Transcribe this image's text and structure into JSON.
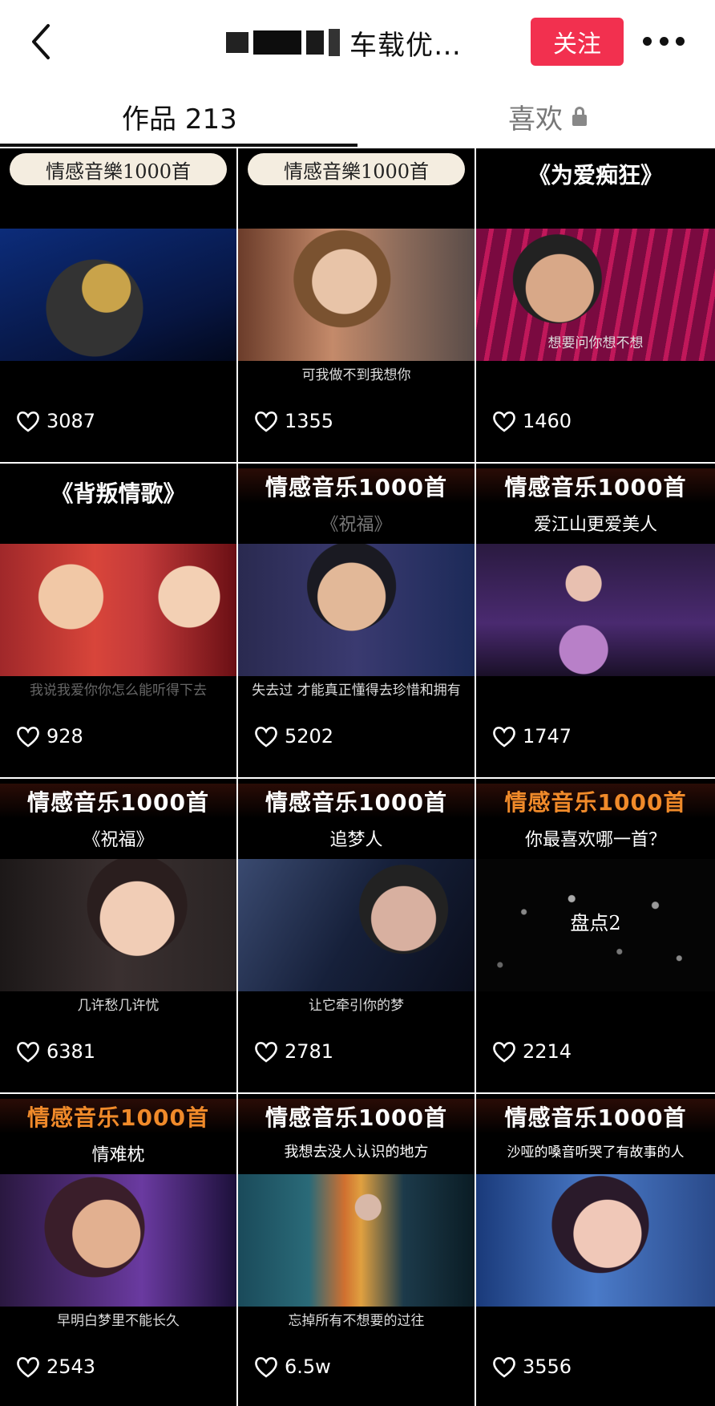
{
  "header": {
    "title": "车载优…",
    "follow_label": "关注"
  },
  "tabs": {
    "works_label": "作品 213",
    "likes_label": "喜欢"
  },
  "videos": [
    {
      "banner": "情感音樂1000首",
      "subtitle": "",
      "caption": "",
      "likes": "3087"
    },
    {
      "banner": "情感音樂1000首",
      "subtitle": "",
      "caption": "可我做不到我想你",
      "likes": "1355"
    },
    {
      "banner": "《为爱痴狂》",
      "subtitle": "",
      "caption": "想要问你想不想",
      "likes": "1460"
    },
    {
      "banner": "《背叛情歌》",
      "subtitle": "",
      "caption": "我说我爱你你怎么能听得下去",
      "likes": "928"
    },
    {
      "banner": "情感音乐1000首",
      "subtitle": "《祝福》",
      "caption": "失去过 才能真正懂得去珍惜和拥有",
      "likes": "5202"
    },
    {
      "banner": "情感音乐1000首",
      "subtitle": "爱江山更爱美人",
      "caption": "",
      "likes": "1747"
    },
    {
      "banner": "情感音乐1000首",
      "subtitle": "《祝福》",
      "caption": "几许愁几许忧",
      "likes": "6381"
    },
    {
      "banner": "情感音乐1000首",
      "subtitle": "追梦人",
      "caption": "让它牵引你的梦",
      "likes": "2781"
    },
    {
      "banner": "情感音乐1000首",
      "subtitle": "你最喜欢哪一首？",
      "caption": "",
      "likes": "2214",
      "overlay": "盘点2"
    },
    {
      "banner": "情感音乐1000首",
      "subtitle": "情难枕",
      "caption": "早明白梦里不能长久",
      "likes": "2543"
    },
    {
      "banner": "情感音乐1000首",
      "subtitle": "我想去没人认识的地方",
      "caption": "忘掉所有不想要的过往",
      "likes": "6.5w"
    },
    {
      "banner": "情感音乐1000首",
      "subtitle": "沙哑的嗓音听哭了有故事的人",
      "caption": "",
      "likes": "3556"
    }
  ],
  "colors": {
    "follow_bg": "#f2304f",
    "orange_banner": "#f08a2a"
  },
  "icons": {
    "back": "chevron-left-icon",
    "more": "ellipsis-icon",
    "lock": "lock-icon",
    "heart": "heart-outline-icon"
  }
}
